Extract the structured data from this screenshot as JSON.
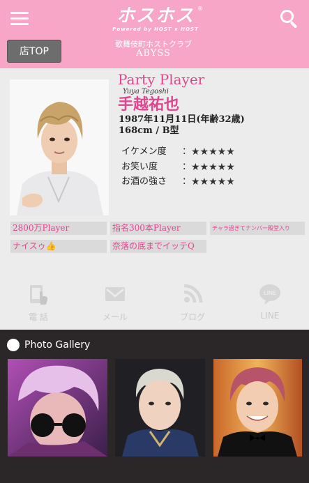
{
  "header": {
    "logo_main": "ホスホス",
    "logo_reg": "®",
    "logo_sub": "Powered by HOST x HOST",
    "store_top_label": "店TOP",
    "club_genre": "歌舞伎町ホストクラブ",
    "club_name": "ABYSS"
  },
  "profile": {
    "role": "Party Player",
    "romaji": "Yuya Tegoshi",
    "name": "手越祐也",
    "birth": "1987年11月11日(年齢32歳)",
    "height_blood": "168cm / B型",
    "stats": [
      {
        "label": "イケメン度",
        "colon": "：",
        "stars": "★★★★★"
      },
      {
        "label": "お笑い度",
        "colon": "：",
        "stars": "★★★★★"
      },
      {
        "label": "お酒の強さ",
        "colon": "：",
        "stars": "★★★★★"
      }
    ],
    "tags": [
      "2800万Player",
      "指名300本Player",
      "チャラ過ぎてナンバー殿堂入り",
      "ナイスゥ👍",
      "奈落の底までイッテQ"
    ]
  },
  "contact": {
    "phone_label": "電 話",
    "mail_label": "メール",
    "blog_label": "ブログ",
    "line_label": "LINE",
    "line_icon_text": "LINE"
  },
  "gallery": {
    "title": "Photo Gallery"
  },
  "colors": {
    "header_pink": "#f7a6c8",
    "accent_pink": "#e0468f",
    "gallery_bg": "#2b2627"
  }
}
